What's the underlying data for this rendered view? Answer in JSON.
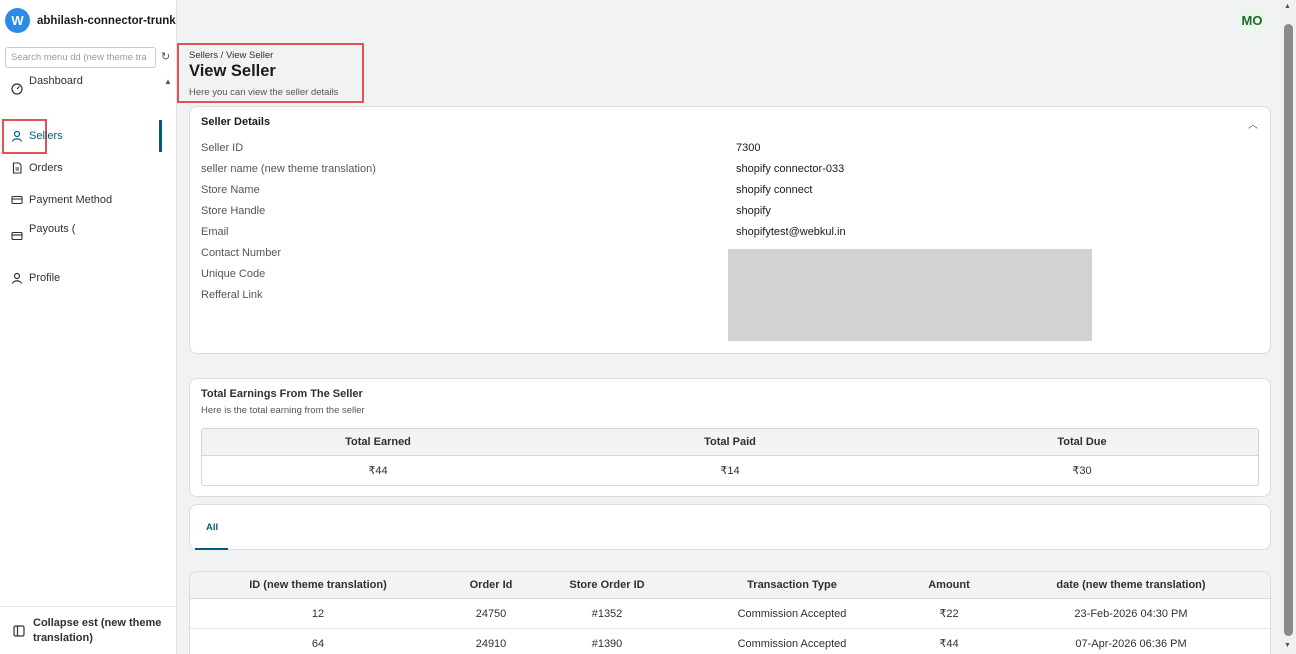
{
  "app": {
    "logo_letter": "W",
    "name": "abhilash-connector-trunk"
  },
  "sidebar": {
    "search_placeholder": "Search menu dd (new theme tra",
    "items": [
      {
        "label": "Dashboard",
        "icon": "gauge-icon"
      },
      {
        "label": "Sellers",
        "icon": "user-icon",
        "active": true
      },
      {
        "label": "Orders",
        "icon": "document-icon"
      },
      {
        "label": "Payment Method",
        "icon": "card-icon"
      },
      {
        "label": "Payouts (",
        "icon": "card-icon"
      },
      {
        "label": "Profile",
        "icon": "user-icon"
      }
    ],
    "collapse_label": "Collapse est (new theme translation)"
  },
  "user": {
    "initials": "MO"
  },
  "header": {
    "breadcrumb": "Sellers / View Seller",
    "title": "View Seller",
    "subtitle": "Here you can view the seller details"
  },
  "seller_details": {
    "title": "Seller Details",
    "rows": [
      {
        "label": "Seller ID",
        "value": "7300"
      },
      {
        "label": "seller name (new theme translation)",
        "value": "shopify connector-033"
      },
      {
        "label": "Store Name",
        "value": "shopify connect"
      },
      {
        "label": "Store Handle",
        "value": "shopify"
      },
      {
        "label": "Email",
        "value": "shopifytest@webkul.in"
      },
      {
        "label": "Contact Number",
        "value": ""
      },
      {
        "label": "Unique Code",
        "value": ""
      },
      {
        "label": "Refferal Link",
        "value": ""
      }
    ]
  },
  "earnings": {
    "title": "Total Earnings From The Seller",
    "subtitle": "Here is the total earning from the seller",
    "headers": [
      "Total Earned",
      "Total Paid",
      "Total Due"
    ],
    "values": [
      "₹44",
      "₹14",
      "₹30"
    ]
  },
  "tabs": {
    "all_label": "All"
  },
  "transactions": {
    "headers": [
      "ID (new theme translation)",
      "Order Id",
      "Store Order ID",
      "Transaction Type",
      "Amount",
      "date (new theme translation)"
    ],
    "rows": [
      [
        "12",
        "24750",
        "#1352",
        "Commission Accepted",
        "₹22",
        "23-Feb-2026 04:30 PM"
      ],
      [
        "64",
        "24910",
        "#1390",
        "Commission Accepted",
        "₹44",
        "07-Apr-2026 06:36 PM"
      ]
    ]
  },
  "colors": {
    "accent": "#005f73",
    "brand": "#2b8be6",
    "highlight_border": "#e25353"
  }
}
